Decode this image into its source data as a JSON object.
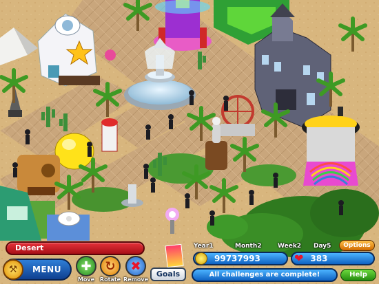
{
  "hud": {
    "zone_name": "Desert",
    "menu_label": "MENU",
    "tools": [
      {
        "label": "Move",
        "icon": "move-arrows-icon",
        "color": "#2fa62f"
      },
      {
        "label": "Rotate",
        "icon": "rotate-icon",
        "color": "#f0a21a"
      },
      {
        "label": "Remove",
        "icon": "remove-x-icon",
        "color": "#1c6fd1"
      }
    ],
    "goals_label": "Goals",
    "date": {
      "year": "Year1",
      "month": "Month2",
      "week": "Week2",
      "day": "Day5"
    },
    "options_label": "Options",
    "money": "99737993",
    "hearts": "383",
    "challenge_status": "All challenges are complete!",
    "help_label": "Help"
  },
  "colors": {
    "sand": "#d9b982",
    "path": "#c9a57a",
    "grass": "#3f8e2d",
    "hud_blue": "#1e7fd9",
    "hud_red": "#d8232b"
  }
}
